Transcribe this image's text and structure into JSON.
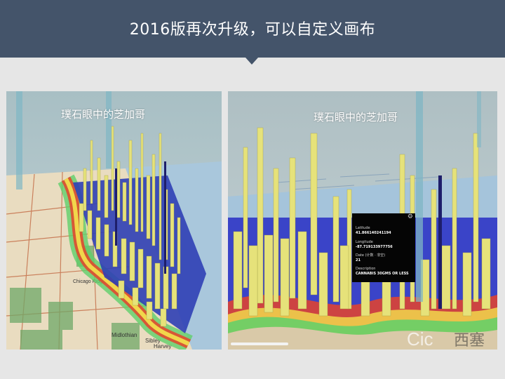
{
  "header": {
    "title": "2016版再次升级，可以自定义画布",
    "background": "#44546a"
  },
  "left_panel": {
    "title": "璞石眼中的芝加哥",
    "map_labels": [
      "Midlothian",
      "Sibley",
      "Harvey",
      "Chicago Ridge"
    ]
  },
  "right_panel": {
    "title": "璞石眼中的芝加哥",
    "tooltip": {
      "icon": "gear-icon",
      "fields": [
        {
          "label": "Latitude",
          "value": "41.866140241194"
        },
        {
          "label": "Longitude",
          "value": "-87.719133977756"
        },
        {
          "label": "Date (计数 · 非空)",
          "value": "21"
        },
        {
          "label": "Description",
          "value": "CANNABIS 30GMS OR LESS"
        }
      ]
    },
    "map_labels": [
      "Cic",
      "西塞"
    ]
  },
  "colors": {
    "page_bg": "#e6e6e6",
    "bar_yellow": "#e6e27a",
    "bar_blue": "#2a3ec9",
    "heat_red": "#e8432a",
    "heat_green": "#5fd06a"
  }
}
